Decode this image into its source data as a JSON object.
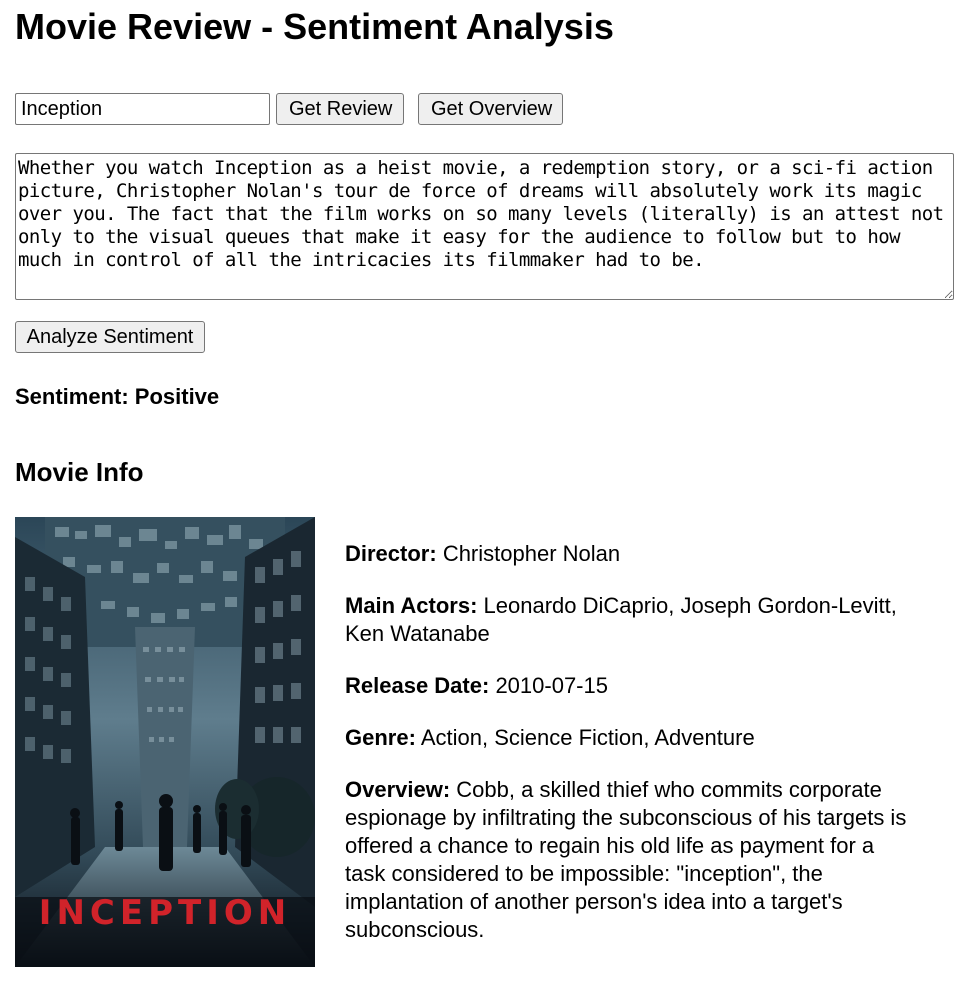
{
  "page": {
    "title": "Movie Review - Sentiment Analysis"
  },
  "search": {
    "value": "Inception"
  },
  "buttons": {
    "get_review": "Get Review",
    "get_overview": "Get Overview",
    "analyze_sentiment": "Analyze Sentiment"
  },
  "review": {
    "text": "Whether you watch Inception as a heist movie, a redemption story, or a sci-fi action picture, Christopher Nolan's tour de force of dreams will absolutely work its magic over you. The fact that the film works on so many levels (literally) is an attest not only to the visual queues that make it easy for the audience to follow but to how much in control of all the intricacies its filmmaker had to be."
  },
  "sentiment": {
    "text": "Sentiment: Positive"
  },
  "movie_info": {
    "heading": "Movie Info",
    "poster_title": "INCEPTION",
    "director_label": "Director:",
    "director": "Christopher Nolan",
    "actors_label": "Main Actors:",
    "actors": "Leonardo DiCaprio, Joseph Gordon-Levitt, Ken Watanabe",
    "release_label": "Release Date:",
    "release_date": "2010-07-15",
    "genre_label": "Genre:",
    "genre": "Action, Science Fiction, Adventure",
    "overview_label": "Overview:",
    "overview": "Cobb, a skilled thief who commits corporate espionage by infiltrating the subconscious of his targets is offered a chance to regain his old life as payment for a task considered to be impossible: \"inception\", the implantation of another person's idea into a target's subconscious."
  },
  "colors": {
    "poster_title": "#d1232a",
    "button_bg": "#efefef",
    "border": "#767676"
  }
}
